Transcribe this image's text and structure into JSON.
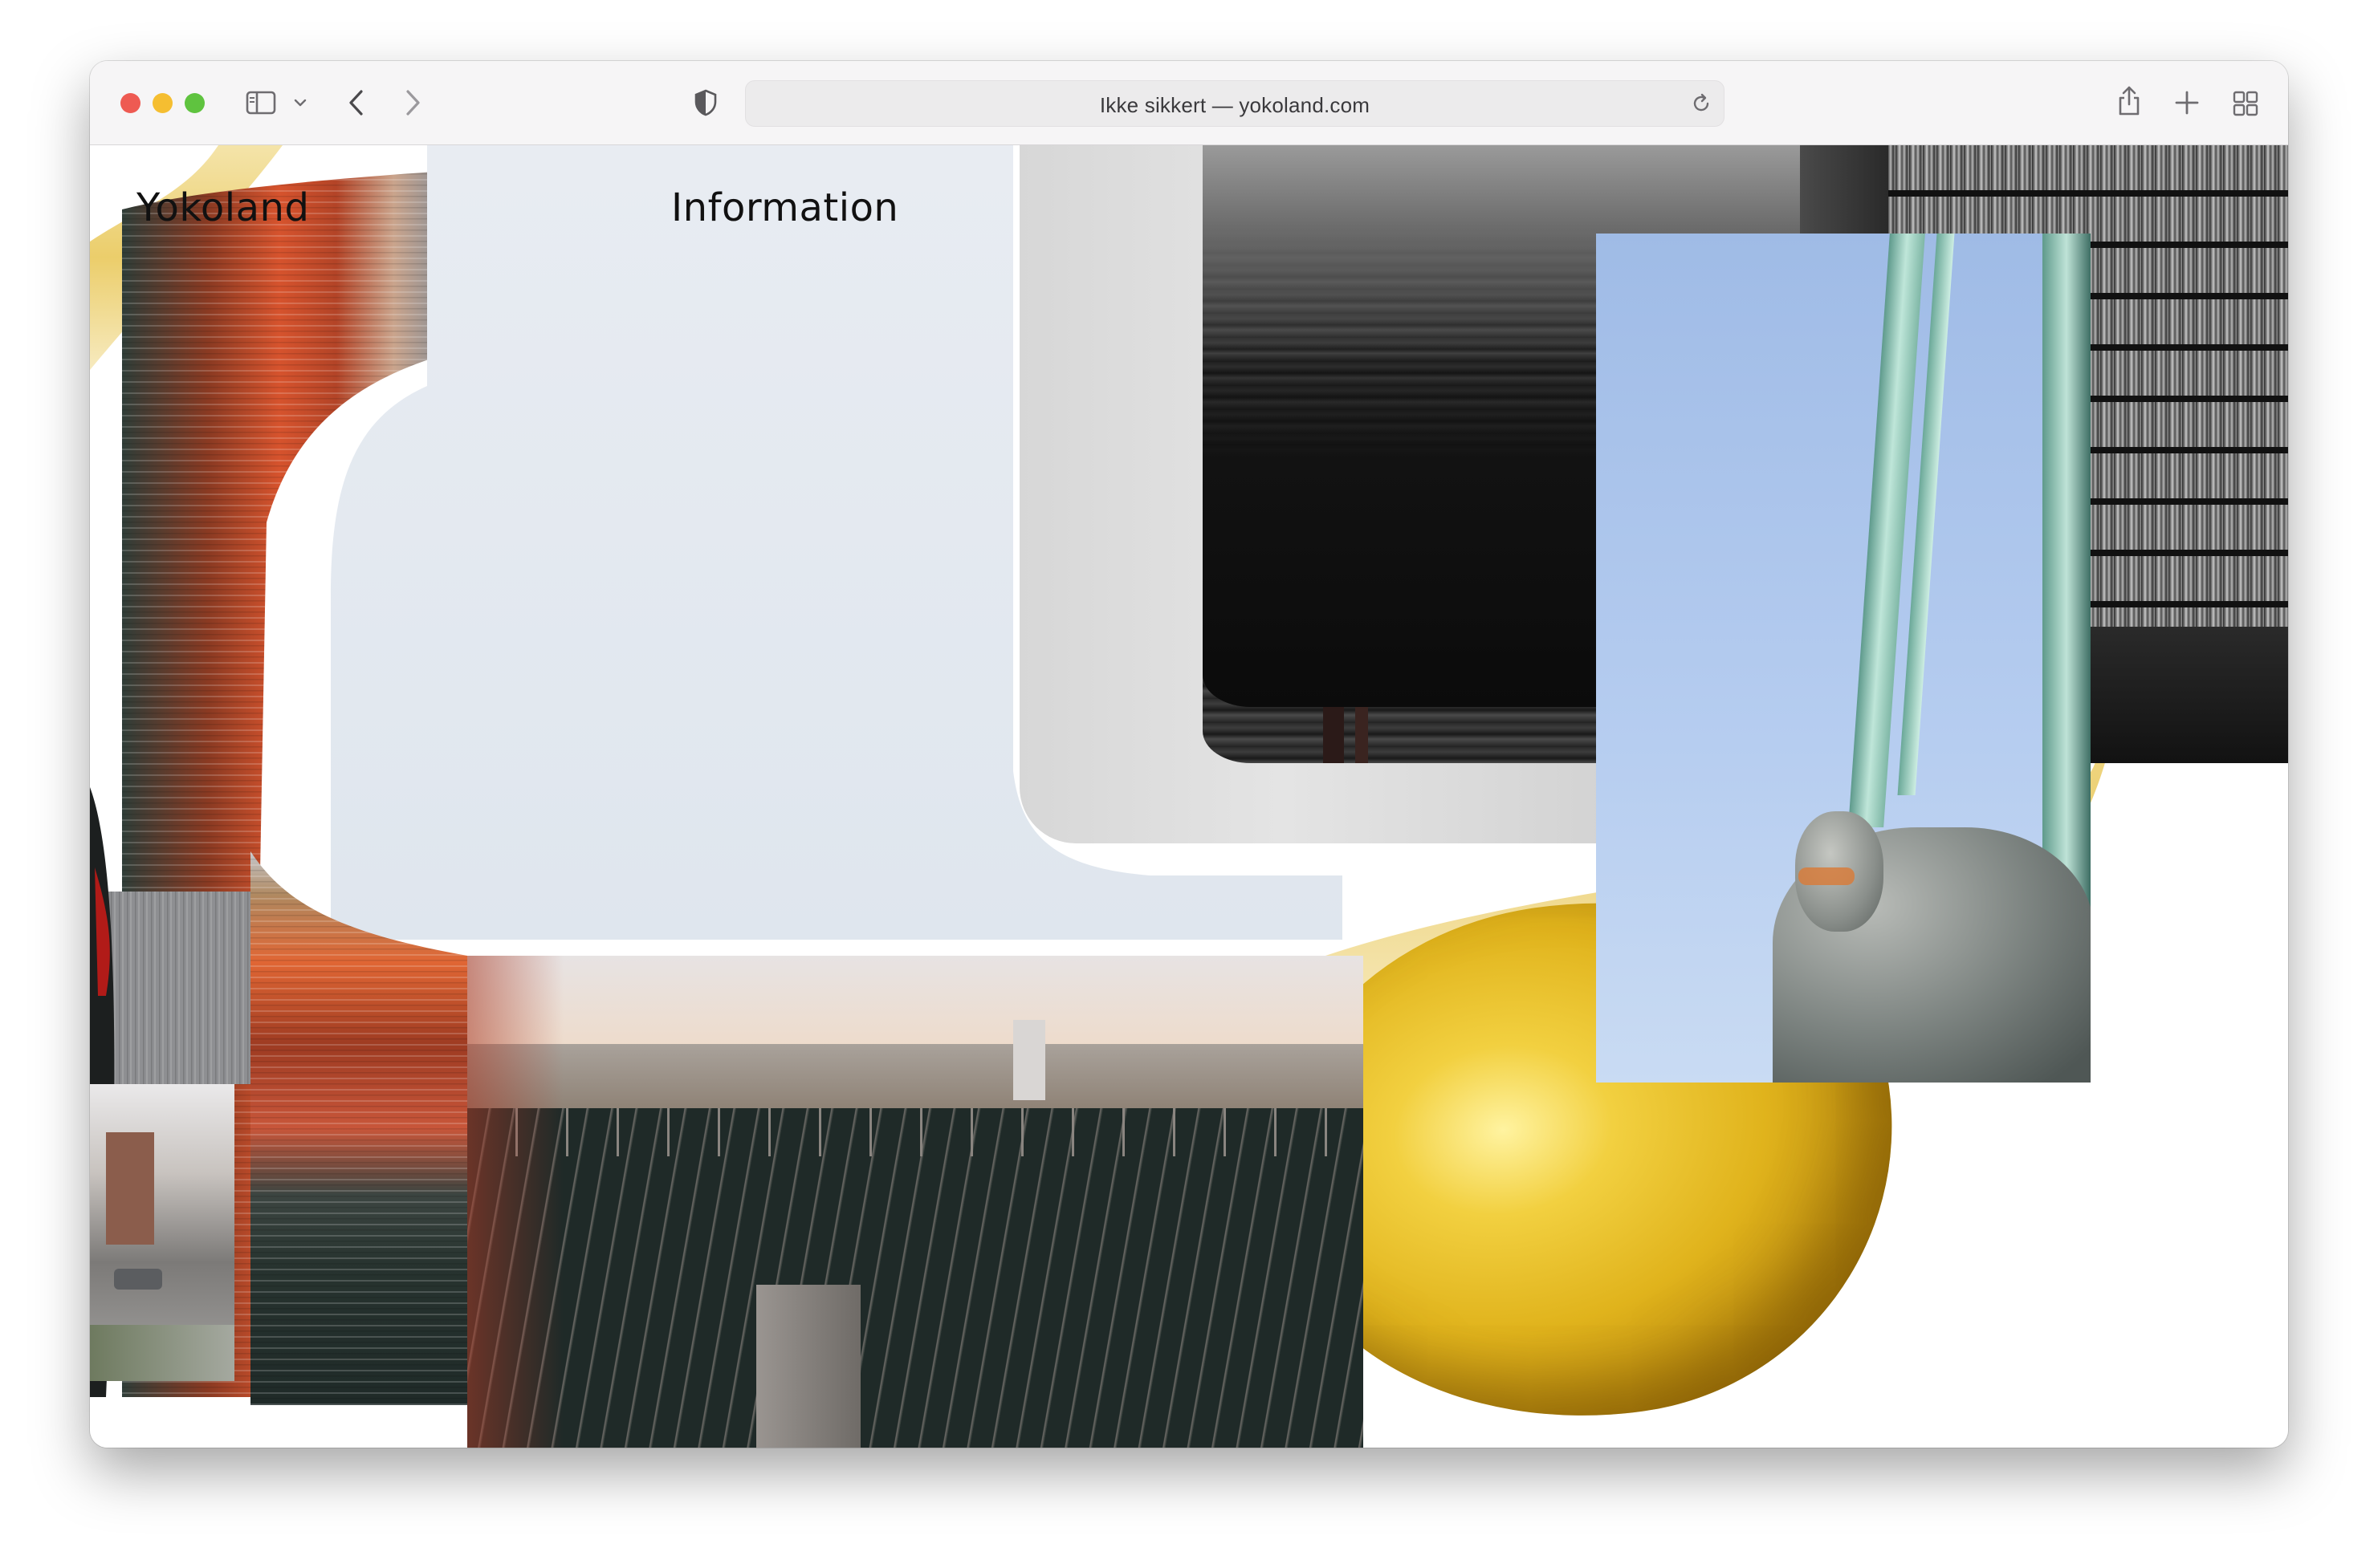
{
  "browser": {
    "address": "Ikke sikkert — yokoland.com",
    "icons": [
      "sidebar-icon",
      "chevron-down-icon",
      "back-icon",
      "forward-icon",
      "shield-icon",
      "reload-icon",
      "share-icon",
      "new-tab-icon",
      "tab-overview-icon"
    ],
    "traffic_lights": {
      "close": "#ee5a52",
      "minimize": "#f5be31",
      "zoom": "#5fc33f"
    }
  },
  "site": {
    "logo": "Yokoland",
    "nav_information": "Information"
  },
  "collage": {
    "images": [
      "striped-warped-image",
      "railway-yard-photo",
      "black-record-photo",
      "lemon-photo",
      "statue-sky-photo",
      "bookshelf-photo",
      "street-photo"
    ]
  }
}
